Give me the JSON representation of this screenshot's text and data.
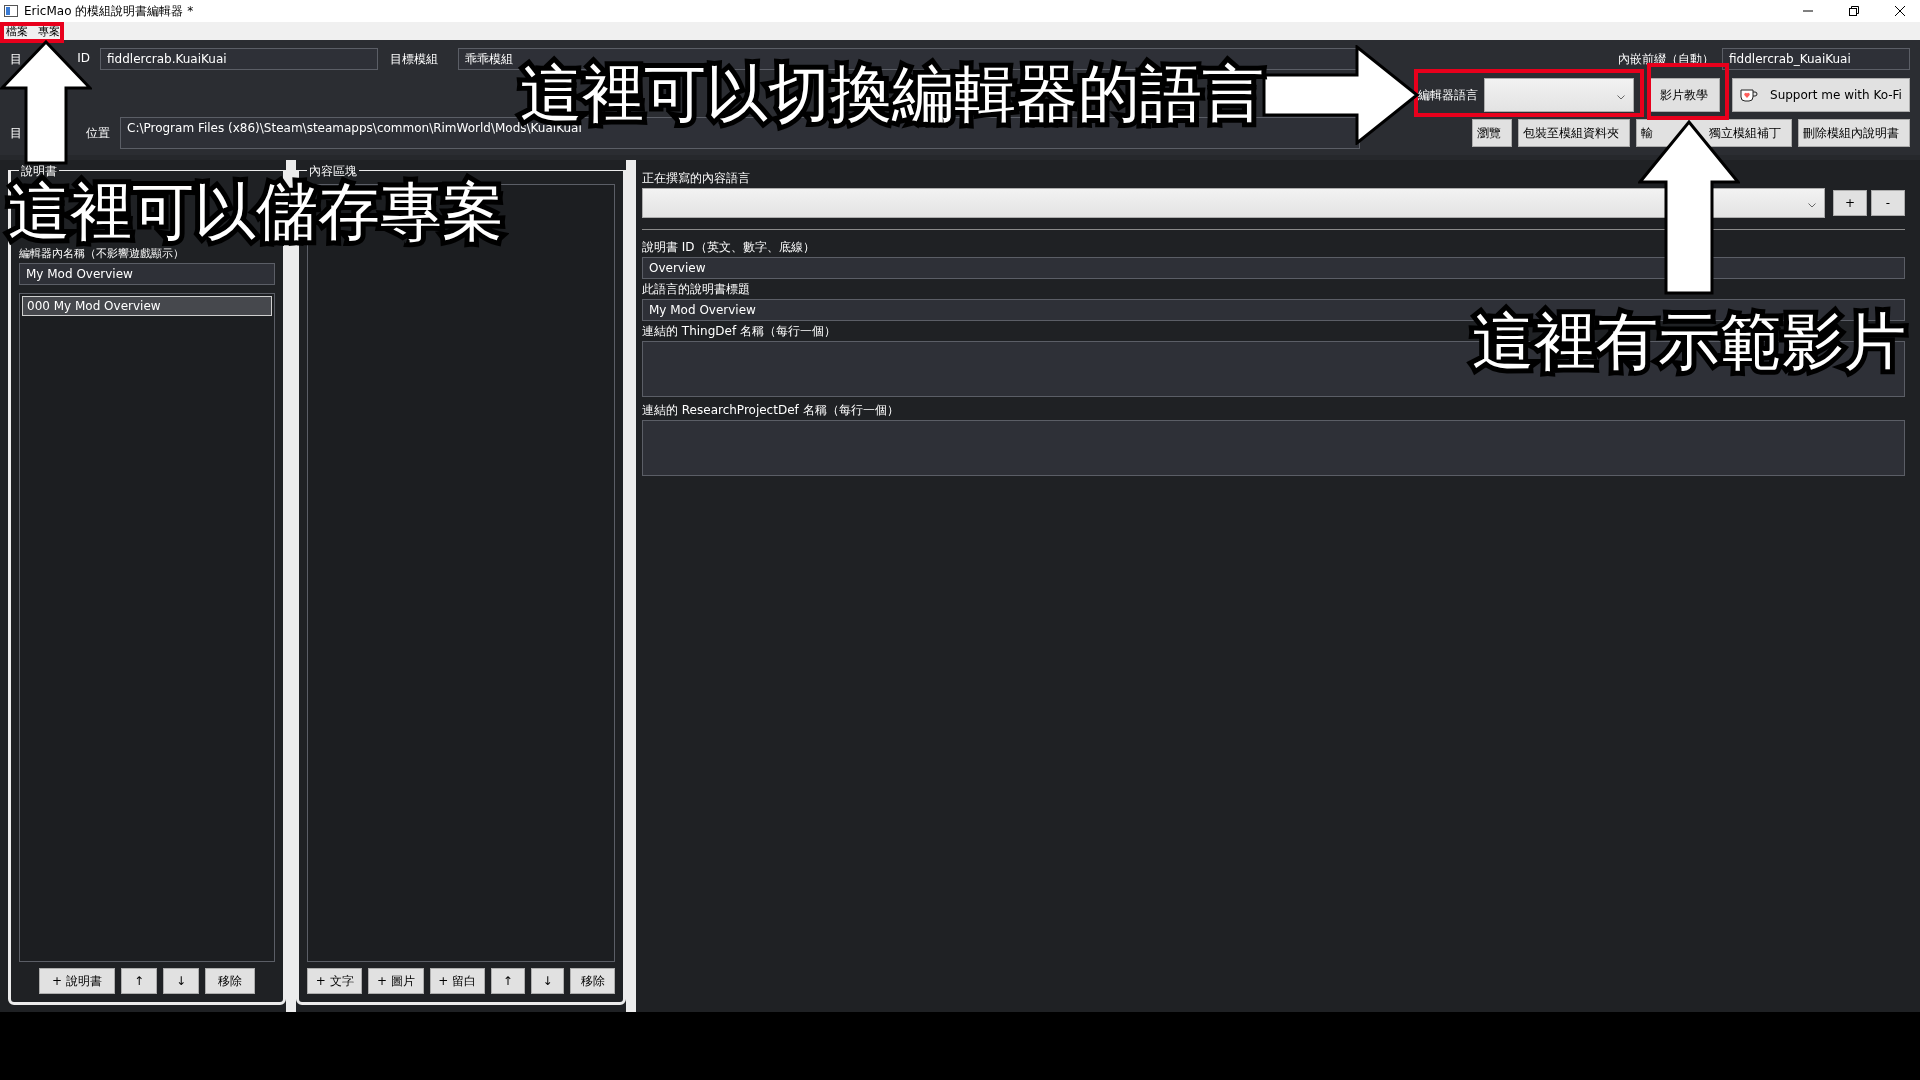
{
  "window": {
    "title": "EricMao 的模組說明書編輯器 *"
  },
  "menu": [
    {
      "label": "檔案"
    },
    {
      "label": "專案"
    }
  ],
  "header": {
    "mod_id_label_parts": [
      "目",
      "ID"
    ],
    "mod_id": "fiddlercrab.KuaiKuai",
    "target_mod_label": "目標模組",
    "target_mod": "乖乖模組",
    "prefix_label": "內嵌前綴（自動）",
    "prefix": "fiddlercrab_KuaiKuai",
    "editor_language_label": "編輯器語言",
    "video_button": "影片教學",
    "kofi_button": "Support me with Ko-Fi",
    "path_label_parts": [
      "目",
      "位置"
    ],
    "path": "C:\\Program Files (x86)\\Steam\\steamapps\\common\\RimWorld\\Mods\\KuaiKuai",
    "buttons": [
      {
        "parts": [
          "瀏覽"
        ]
      },
      {
        "parts": [
          "包裝至模組資料夾"
        ]
      },
      {
        "parts": [
          "輸",
          "獨立模組補丁"
        ]
      },
      {
        "parts": [
          "刪除模組內說明書"
        ]
      }
    ]
  },
  "docs_panel": {
    "title": "說明書",
    "name_label": "編輯器內名稱（不影響遊戲顯示）",
    "name": "My Mod Overview",
    "items": [
      {
        "label": "000  My Mod Overview",
        "selected": true
      }
    ],
    "buttons": [
      "+ 說明書",
      "↑",
      "↓",
      "移除"
    ]
  },
  "blocks_panel": {
    "title": "內容區塊",
    "buttons": [
      "+ 文字",
      "+ 圖片",
      "+ 留白",
      "↑",
      "↓",
      "移除"
    ]
  },
  "editor": {
    "language_label": "正在撰寫的內容語言",
    "add_button": "+",
    "remove_button": "-",
    "fields": [
      {
        "label": "說明書 ID（英文、數字、底線）",
        "value": "Overview",
        "kind": "line"
      },
      {
        "label": "此語言的說明書標題",
        "value": "My Mod Overview",
        "kind": "line"
      },
      {
        "label": "連結的 ThingDef 名稱（每行一個）",
        "kind": "area"
      },
      {
        "label": "連結的 ResearchProjectDef 名稱（每行一個）",
        "kind": "area"
      }
    ]
  },
  "annotations": {
    "save_hint": "這裡可以儲存專案",
    "language_hint": "這裡可以切換編輯器的語言",
    "video_hint": "這裡有示範影片"
  }
}
